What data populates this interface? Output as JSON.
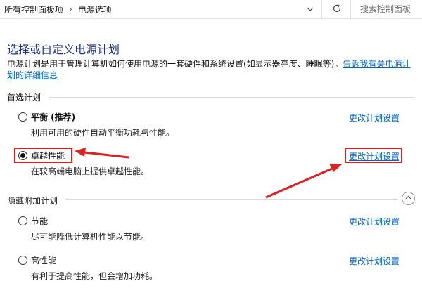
{
  "address_bar": {
    "crumbs": [
      "所有控制面板项",
      "电源选项"
    ],
    "separator": "›",
    "search_placeholder": "搜索控制面板"
  },
  "main": {
    "title": "选择或自定义电源计划",
    "description": "电源计划是用于管理计算机如何使用电源的一套硬件和系统设置(如显示器亮度、睡眠等)。",
    "description_link": "告诉我有关电源计划的详细信息"
  },
  "preferred_group": {
    "title": "首选计划",
    "plans": [
      {
        "name": "平衡 (推荐)",
        "description": "利用可用的硬件自动平衡功耗与性能。",
        "change_link": "更改计划设置",
        "selected": false
      },
      {
        "name": "卓越性能",
        "description": "在较高端电脑上提供卓越性能。",
        "change_link": "更改计划设置",
        "selected": true
      }
    ]
  },
  "hidden_group": {
    "title": "隐藏附加计划",
    "plans": [
      {
        "name": "节能",
        "description": "尽可能降低计算机性能以节能。",
        "change_link": "更改计划设置",
        "selected": false
      },
      {
        "name": "高性能",
        "description": "有利于提高性能，但会增加功耗。",
        "change_link": "更改计划设置",
        "selected": false
      }
    ]
  },
  "colors": {
    "title": "#1e3287",
    "link": "#0066cc",
    "annotation": "#e02020"
  }
}
